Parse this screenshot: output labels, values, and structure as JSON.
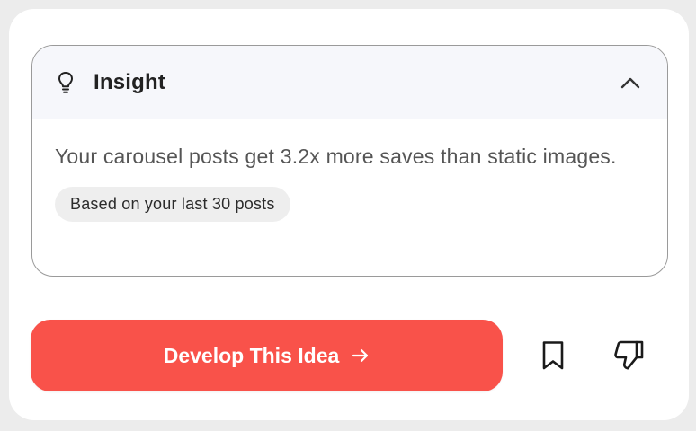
{
  "insight": {
    "title": "Insight",
    "text": "Your carousel posts get 3.2x more saves than static images.",
    "tag": "Based on your last 30 posts",
    "icons": {
      "header": "lightbulb-icon",
      "toggle": "chevron-up-icon"
    }
  },
  "actions": {
    "develop_label": "Develop This Idea",
    "develop_icon": "arrow-right-icon",
    "bookmark_icon": "bookmark-icon",
    "dislike_icon": "thumbs-down-icon"
  },
  "colors": {
    "accent": "#f9524a",
    "header_bg": "#f6f7fb",
    "tag_bg": "#eeeeee",
    "border": "#9a9a9a"
  }
}
